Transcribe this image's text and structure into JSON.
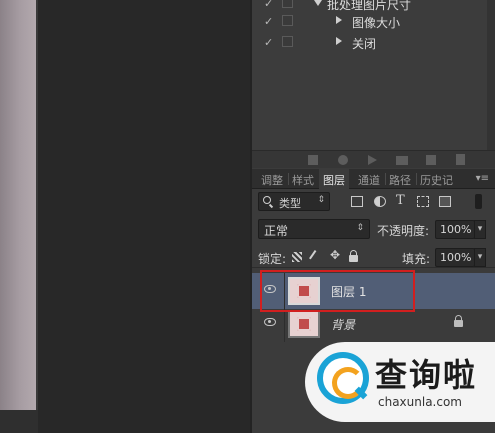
{
  "actions": {
    "rows": [
      {
        "check": "✓",
        "label": "批处理图片尺寸",
        "expanded": true
      },
      {
        "check": "✓",
        "label": "图像大小",
        "expanded": false
      },
      {
        "check": "✓",
        "label": "关闭",
        "expanded": false
      }
    ]
  },
  "panel_tabs": [
    "调整",
    "样式",
    "图层",
    "通道",
    "路径",
    "历史记"
  ],
  "active_tab": "图层",
  "filter": {
    "label": "类型"
  },
  "blend": {
    "mode": "正常",
    "opacity_label": "不透明度:",
    "opacity_value": "100%"
  },
  "lock": {
    "label": "锁定:",
    "fill_label": "填充:",
    "fill_value": "100%"
  },
  "layers": [
    {
      "name": "图层 1",
      "selected": true,
      "visible": true,
      "locked": false
    },
    {
      "name": "背景",
      "selected": false,
      "visible": true,
      "locked": true
    }
  ],
  "watermark": {
    "title": "查询啦",
    "url": "chaxunla.com"
  },
  "colors": {
    "highlight": "#d21f1f",
    "selection": "#515e76",
    "brand_blue": "#1aa3d6",
    "brand_orange": "#f3a21e"
  }
}
